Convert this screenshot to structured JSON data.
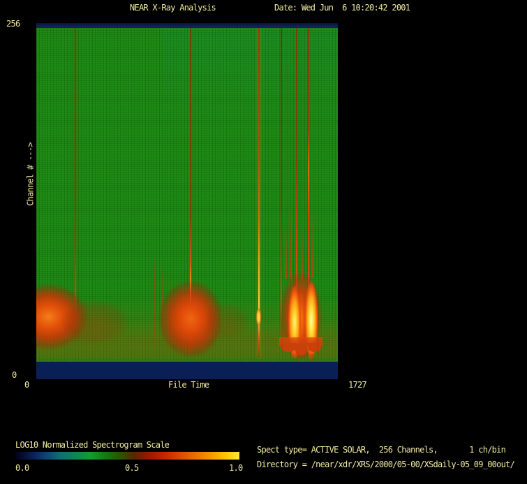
{
  "window": {
    "background_color": "#000000",
    "text_color": "#f2eca2",
    "plot_base_green": "#1e8b12",
    "plot_band_navy": "#0a1f55"
  },
  "header": {
    "title": "NEAR X-Ray Analysis",
    "date": "Date: Wed Jun  6 10:20:42 2001"
  },
  "y_axis": {
    "label": "Channel # --->",
    "max_tick": "256",
    "min_tick": "0"
  },
  "x_axis": {
    "label": "File Time",
    "min_tick": "0",
    "max_tick": "1727"
  },
  "colorbar": {
    "label": "LOG10 Normalized Spectrogram Scale",
    "ticks": [
      "0.0",
      "0.5",
      "1.0"
    ],
    "gradient_stops": [
      "#010114",
      "#081a4e",
      "#0f3f74",
      "#0f6e74",
      "#0e8455",
      "#129e2e",
      "#117c12",
      "#275700",
      "#5c2500",
      "#a01800",
      "#c52600",
      "#dc4800",
      "#ec6d00",
      "#f69300",
      "#ffc100",
      "#ffe93c"
    ]
  },
  "info": {
    "spect_line": "Spect type= ACTIVE SOLAR,  256 Channels,       1 ch/bin",
    "directory_line": "Directory = /near/xdr/XRS/2000/05-00/XSdaily-05_09_00out/"
  },
  "chart_data": {
    "type": "heatmap",
    "title": "NEAR X-Ray Analysis",
    "xlabel": "File Time",
    "ylabel": "Channel #",
    "xlim": [
      0,
      1727
    ],
    "ylim": [
      0,
      256
    ],
    "colorbar_label": "LOG10 Normalized Spectrogram Scale",
    "colorbar_range": [
      0.0,
      1.0
    ],
    "background_level": "green (~0.4 normalized)",
    "events": [
      {
        "file_time": 222,
        "channel_range": [
          0,
          256
        ],
        "intensity": "low-medium",
        "description": "narrow dark-red vertical streak"
      },
      {
        "file_time_range": [
          0,
          380
        ],
        "channel_range": [
          0,
          72
        ],
        "intensity": "high",
        "description": "broad red emission blob at left edge, orange core near channel ~20"
      },
      {
        "file_time": 883,
        "channel_range": [
          0,
          256
        ],
        "intensity": "medium",
        "description": "red streak with bright orange core at low channels"
      },
      {
        "file_time_range": [
          660,
          1020
        ],
        "channel_range": [
          0,
          77
        ],
        "intensity": "high",
        "description": "red emission blob with vertical flaring spikes"
      },
      {
        "file_time": 1275,
        "channel_range": [
          0,
          256
        ],
        "intensity": "high",
        "description": "bright orange-yellow full-height streak"
      },
      {
        "file_time": 1403,
        "channel_range": [
          0,
          256
        ],
        "intensity": "medium",
        "description": "red streak, wavy lower end"
      },
      {
        "file_time": 1491,
        "channel_range": [
          0,
          256
        ],
        "intensity": "medium",
        "description": "red streak merging into flare group"
      },
      {
        "file_time": 1559,
        "channel_range": [
          0,
          256
        ],
        "intensity": "medium-high",
        "description": "red-orange streak merging into flare group"
      },
      {
        "file_time_range": [
          1391,
          1639
        ],
        "channel_range": [
          0,
          123
        ],
        "intensity": "saturated",
        "description": "brightest yellow-white flare group at low channels"
      }
    ]
  }
}
